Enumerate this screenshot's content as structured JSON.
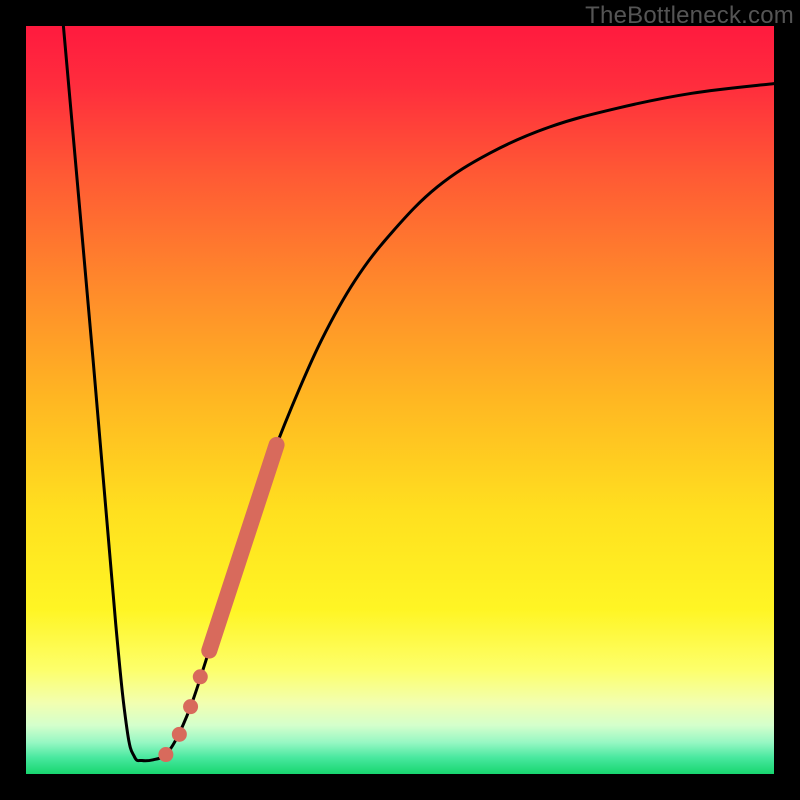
{
  "watermark": "TheBottleneck.com",
  "chart_data": {
    "type": "line",
    "title": "",
    "xlabel": "",
    "ylabel": "",
    "xlim": [
      0,
      100
    ],
    "ylim": [
      0,
      100
    ],
    "background_gradient": {
      "stops": [
        {
          "offset": 0.0,
          "color": "#ff1a3e"
        },
        {
          "offset": 0.08,
          "color": "#ff2d3d"
        },
        {
          "offset": 0.2,
          "color": "#ff5a34"
        },
        {
          "offset": 0.35,
          "color": "#ff8a2b"
        },
        {
          "offset": 0.5,
          "color": "#ffb722"
        },
        {
          "offset": 0.65,
          "color": "#ffe01f"
        },
        {
          "offset": 0.78,
          "color": "#fff524"
        },
        {
          "offset": 0.86,
          "color": "#fdff6a"
        },
        {
          "offset": 0.905,
          "color": "#f2ffb0"
        },
        {
          "offset": 0.935,
          "color": "#d4ffcc"
        },
        {
          "offset": 0.958,
          "color": "#96f7c3"
        },
        {
          "offset": 0.978,
          "color": "#49e89f"
        },
        {
          "offset": 1.0,
          "color": "#17d66f"
        }
      ]
    },
    "series": [
      {
        "name": "curve",
        "style": "black-line",
        "points": [
          {
            "x": 5.0,
            "y": 100.0
          },
          {
            "x": 9.0,
            "y": 55.0
          },
          {
            "x": 12.0,
            "y": 20.0
          },
          {
            "x": 13.5,
            "y": 6.0
          },
          {
            "x": 14.5,
            "y": 2.3
          },
          {
            "x": 15.5,
            "y": 1.8
          },
          {
            "x": 17.0,
            "y": 1.9
          },
          {
            "x": 18.5,
            "y": 2.5
          },
          {
            "x": 20.0,
            "y": 4.5
          },
          {
            "x": 22.0,
            "y": 9.0
          },
          {
            "x": 24.0,
            "y": 15.0
          },
          {
            "x": 26.5,
            "y": 23.0
          },
          {
            "x": 29.0,
            "y": 31.0
          },
          {
            "x": 32.0,
            "y": 40.0
          },
          {
            "x": 35.5,
            "y": 49.0
          },
          {
            "x": 39.5,
            "y": 58.0
          },
          {
            "x": 44.0,
            "y": 66.0
          },
          {
            "x": 49.0,
            "y": 72.5
          },
          {
            "x": 55.0,
            "y": 78.5
          },
          {
            "x": 62.0,
            "y": 83.0
          },
          {
            "x": 70.0,
            "y": 86.5
          },
          {
            "x": 79.0,
            "y": 89.0
          },
          {
            "x": 89.0,
            "y": 91.0
          },
          {
            "x": 100.0,
            "y": 92.3
          }
        ]
      },
      {
        "name": "highlight-band",
        "style": "salmon-thick",
        "points": [
          {
            "x": 24.5,
            "y": 16.5
          },
          {
            "x": 33.5,
            "y": 44.0
          }
        ]
      },
      {
        "name": "gap-dot-upper",
        "style": "salmon-dot",
        "points": [
          {
            "x": 23.3,
            "y": 13.0
          }
        ]
      },
      {
        "name": "gap-dot-mid",
        "style": "salmon-dot",
        "points": [
          {
            "x": 22.0,
            "y": 9.0
          }
        ]
      },
      {
        "name": "gap-dot-lower",
        "style": "salmon-dot",
        "points": [
          {
            "x": 20.5,
            "y": 5.3
          }
        ]
      },
      {
        "name": "bottom-dot",
        "style": "salmon-dot",
        "points": [
          {
            "x": 18.7,
            "y": 2.6
          }
        ]
      }
    ]
  }
}
